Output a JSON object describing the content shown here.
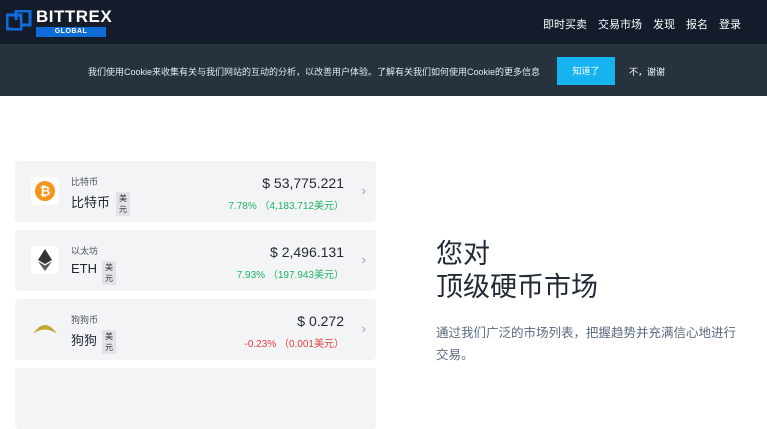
{
  "header": {
    "logo_word": "BITTREX",
    "logo_sub": "GLOBAL",
    "nav": [
      "即时买卖",
      "交易市场",
      "发现",
      "报名",
      "登录"
    ]
  },
  "cookie": {
    "text": "我们使用Cookie来收集有关与我们网站的互动的分析，以改善用户体验。了解有关我们如何使用Cookie的更多信息",
    "accept_label": "知道了",
    "decline_label": "不，谢谢"
  },
  "coins": [
    {
      "sub": "比特币",
      "name": "比特币",
      "unit": "美元",
      "price": "$ 53,775.221",
      "change": "7.78% （4,183.712美元）",
      "direction": "up",
      "icon": "bitcoin-icon",
      "color": "#f7931a"
    },
    {
      "sub": "以太坊",
      "name": "ETH",
      "unit": "美元",
      "price": "$ 2,496.131",
      "change": "7.93% （197.943美元）",
      "direction": "up",
      "icon": "ethereum-icon",
      "color": "#343434"
    },
    {
      "sub": "狗狗币",
      "name": "狗狗",
      "unit": "美元",
      "price": "$ 0.272",
      "change": "-0.23% （0.001美元）",
      "direction": "down",
      "icon": "dogecoin-icon",
      "color": "#c2a633"
    }
  ],
  "hero": {
    "title_line1": "您对",
    "title_line2": "顶级硬币市场",
    "description": "通过我们广泛的市场列表，把握趋势并充满信心地进行交易。"
  },
  "colors": {
    "topbar": "#141b2a",
    "cookiebar": "#27323f",
    "accent": "#15b3ef",
    "up": "#1eb362",
    "down": "#e2403f"
  }
}
